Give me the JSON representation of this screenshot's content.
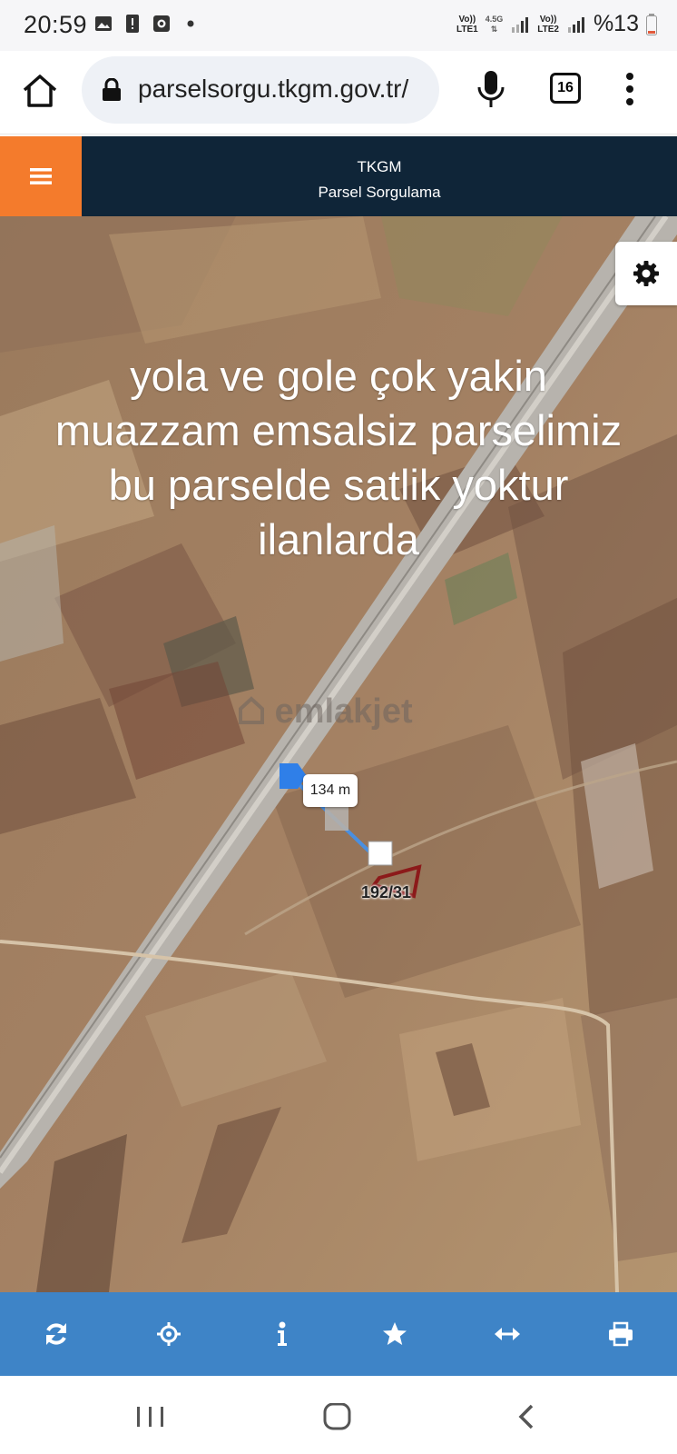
{
  "status_bar": {
    "time": "20:59",
    "sim1": {
      "top": "Vo))",
      "mid": "4.5G",
      "bottom": "LTE1"
    },
    "sim2": {
      "top": "Vo))",
      "bottom": "LTE2"
    },
    "battery": "%13",
    "icons": [
      "image-icon",
      "alert-icon",
      "record-icon",
      "dot-icon"
    ]
  },
  "browser": {
    "url": "parselsorgu.tkgm.gov.tr/",
    "tab_count": "16"
  },
  "app_header": {
    "title": "TKGM",
    "subtitle": "Parsel Sorgulama",
    "accent": "#f47b2c",
    "background": "#0f2538"
  },
  "map": {
    "overlay_lines": [
      "yola ve gole çok yakin",
      "muazzam emsalsiz parselimiz",
      "bu parselde satlik yoktur",
      "ilanlarda"
    ],
    "watermark": "emlakjet",
    "distance_label": "134 m",
    "parcel_label": "192/31"
  },
  "toolbar": {
    "background": "#3e84c7",
    "buttons": [
      "refresh-icon",
      "locate-icon",
      "info-icon",
      "star-icon",
      "measure-icon",
      "print-icon"
    ]
  }
}
